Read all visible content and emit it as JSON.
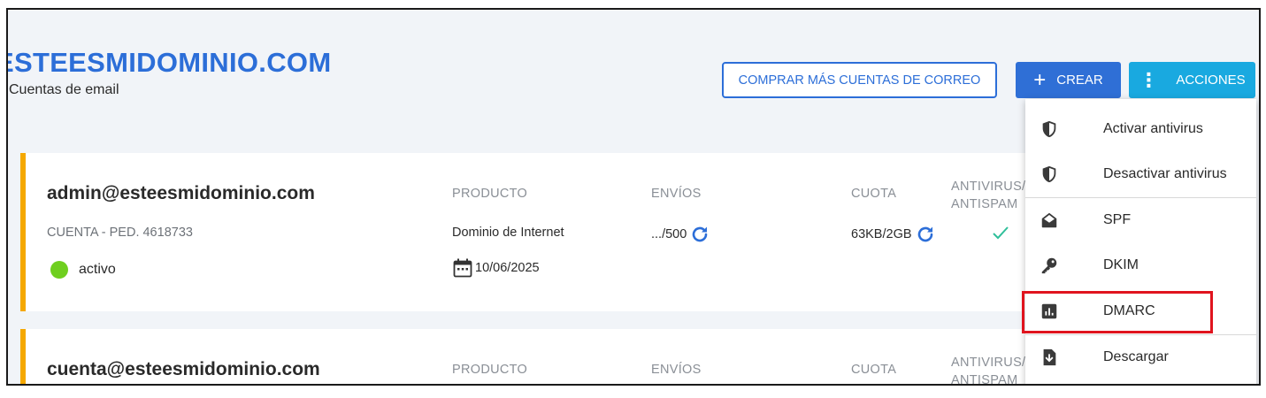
{
  "header": {
    "domain": "ESTEESMIDOMINIO.COM",
    "subtitle": "Cuentas de email",
    "buy_button": "COMPRAR MÁS CUENTAS DE CORREO",
    "create_button": "CREAR",
    "actions_button": "ACCIONES"
  },
  "accounts": [
    {
      "email": "admin@esteesmidominio.com",
      "account_label": "CUENTA - PED. 4618733",
      "status": "activo",
      "status_color": "#6fcf1f",
      "product_header": "PRODUCTO",
      "product": "Dominio de Internet",
      "date": "10/06/2025",
      "sends_header": "ENVÍOS",
      "sends": ".../500",
      "quota_header": "CUOTA",
      "quota": "63KB/2GB",
      "antivirus_header_1": "ANTIVIRUS/",
      "antivirus_header_2": "ANTISPAM"
    },
    {
      "email": "cuenta@esteesmidominio.com",
      "product_header": "PRODUCTO",
      "sends_header": "ENVÍOS",
      "quota_header": "CUOTA",
      "antivirus_header_1": "ANTIVIRUS/",
      "antivirus_header_2": "ANTISPAM"
    }
  ],
  "actions_menu": {
    "items": [
      {
        "label": "Activar antivirus",
        "icon": "shield-icon"
      },
      {
        "label": "Desactivar antivirus",
        "icon": "shield-icon"
      },
      {
        "label": "SPF",
        "icon": "envelope-open-icon"
      },
      {
        "label": "DKIM",
        "icon": "key-icon"
      },
      {
        "label": "DMARC",
        "icon": "chart-icon"
      },
      {
        "label": "Descargar",
        "icon": "download-file-icon"
      }
    ],
    "highlighted": "DMARC"
  },
  "colors": {
    "brand_blue": "#2c6ed8",
    "actions_blue": "#19a9e0",
    "card_accent": "#f5a800",
    "check_green": "#2fbf9a",
    "highlight_red": "#e0141e"
  }
}
